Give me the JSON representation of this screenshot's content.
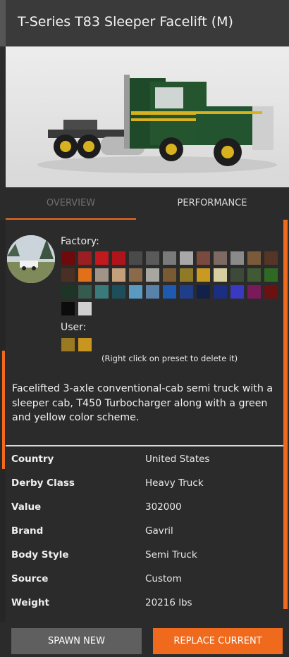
{
  "header": {
    "title": "T-Series T83 Sleeper Facelift (M)"
  },
  "tabs": [
    {
      "label": "OVERVIEW"
    },
    {
      "label": "PERFORMANCE"
    }
  ],
  "colors": {
    "accent": "#f06a1d",
    "background": "#2b2b2b",
    "factory_swatches": [
      "#6e0a0c",
      "#9a1f22",
      "#c0191e",
      "#b0141b",
      "#4a4a4a",
      "#5a5a5a",
      "#7a7a7a",
      "#a8a8a8",
      "#7a4a3e",
      "#7d6a62",
      "#8a8a8a",
      "#7b5a3a",
      "#553528",
      "#4a3024",
      "#e0701a",
      "#a09488",
      "#c4a07a",
      "#8a6a4a",
      "#a8a6a0",
      "#7a5a32",
      "#8f7a28",
      "#c89a22",
      "#d8cfa0",
      "#3d4a38",
      "#425a34",
      "#2f6a24",
      "#1d3526",
      "#355a4e",
      "#3a7a7a",
      "#1e4e5a",
      "#5a9ac0",
      "#5a82a8",
      "#1e5ab0",
      "#1e3e8a",
      "#13204a",
      "#1a2e82",
      "#3a3ac0",
      "#7a1a5a",
      "#6a1212",
      "#0c0c0c",
      "#d0d0d0"
    ],
    "user_swatches": [
      "#9a7a20",
      "#c8961e"
    ]
  },
  "labels": {
    "factory": "Factory:",
    "user": "User:",
    "hint": "(Right click on preset to delete it)"
  },
  "description": "Facelifted 3-axle conventional-cab semi truck with a sleeper cab, T450 Turbocharger along with a green and yellow color scheme.",
  "specs": [
    {
      "key": "Country",
      "value": "United States"
    },
    {
      "key": "Derby Class",
      "value": "Heavy Truck"
    },
    {
      "key": "Value",
      "value": "302000"
    },
    {
      "key": "Brand",
      "value": "Gavril"
    },
    {
      "key": "Body Style",
      "value": "Semi Truck"
    },
    {
      "key": "Source",
      "value": "Custom"
    },
    {
      "key": "Weight",
      "value": "20216 lbs"
    }
  ],
  "buttons": {
    "spawn": "SPAWN NEW",
    "replace": "REPLACE CURRENT"
  }
}
